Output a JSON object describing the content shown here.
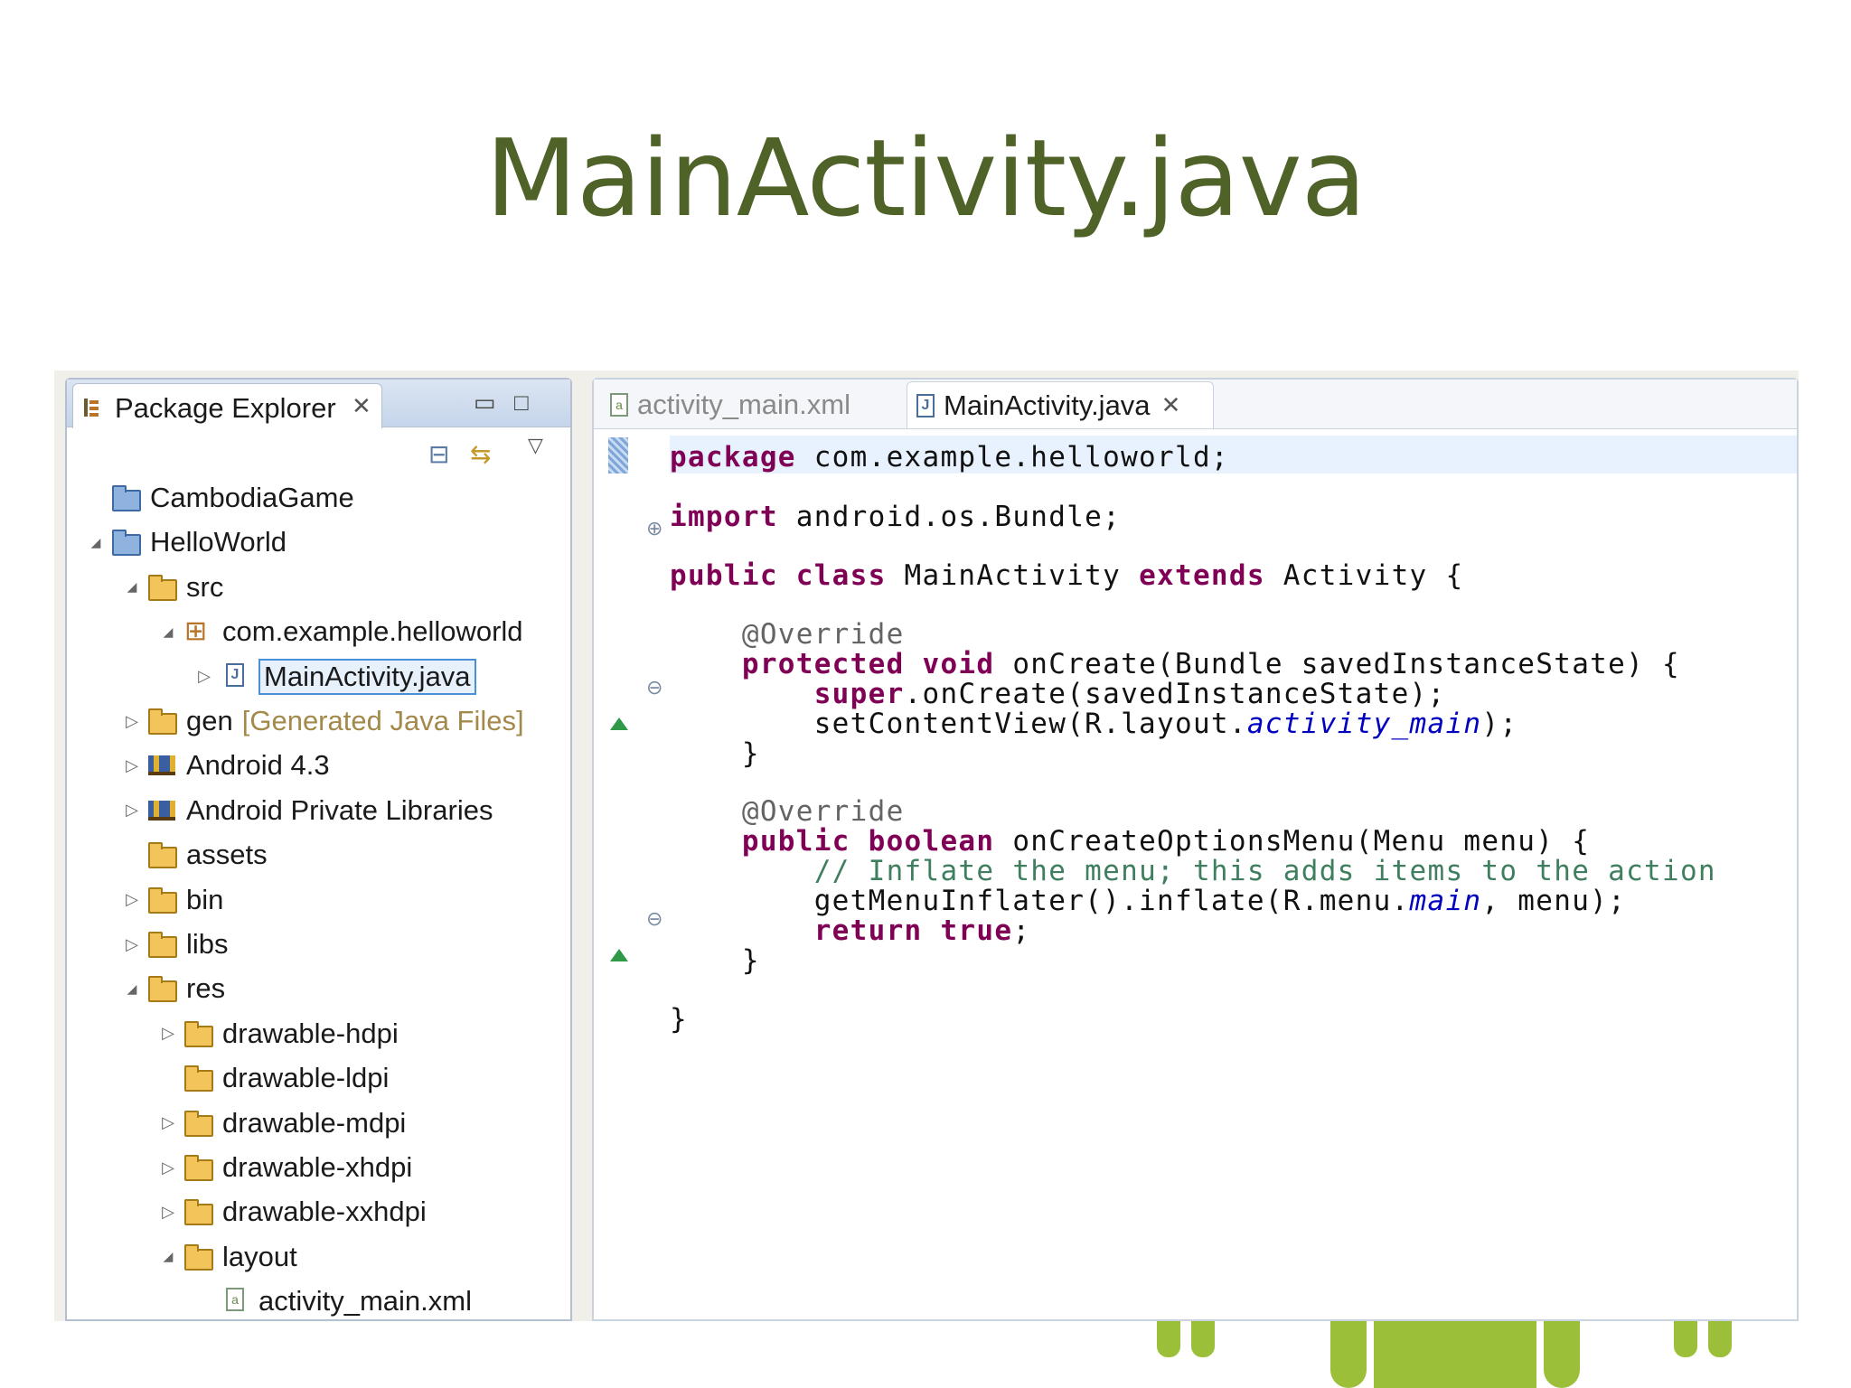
{
  "slide": {
    "title": "MainActivity.java"
  },
  "package_explorer": {
    "title": "Package Explorer",
    "tree": [
      {
        "label": "CambodiaGame",
        "indent": 0,
        "twisty": "",
        "icon": "project-closed-icon"
      },
      {
        "label": "HelloWorld",
        "indent": 0,
        "twisty": "expanded",
        "icon": "android-project-icon"
      },
      {
        "label": "src",
        "indent": 1,
        "twisty": "expanded",
        "icon": "source-folder-icon"
      },
      {
        "label": "com.example.helloworld",
        "indent": 2,
        "twisty": "expanded",
        "icon": "package-icon"
      },
      {
        "label": "MainActivity.java",
        "indent": 3,
        "twisty": "collapsed",
        "icon": "java-file-icon",
        "selected": true
      },
      {
        "label": "gen",
        "decor": "[Generated Java Files]",
        "indent": 1,
        "twisty": "collapsed",
        "icon": "source-folder-icon"
      },
      {
        "label": "Android 4.3",
        "indent": 1,
        "twisty": "collapsed",
        "icon": "library-icon"
      },
      {
        "label": "Android Private Libraries",
        "indent": 1,
        "twisty": "collapsed",
        "icon": "library-icon"
      },
      {
        "label": "assets",
        "indent": 1,
        "twisty": "",
        "icon": "folder-icon"
      },
      {
        "label": "bin",
        "indent": 1,
        "twisty": "collapsed",
        "icon": "folder-icon"
      },
      {
        "label": "libs",
        "indent": 1,
        "twisty": "collapsed",
        "icon": "folder-icon"
      },
      {
        "label": "res",
        "indent": 1,
        "twisty": "expanded",
        "icon": "folder-icon"
      },
      {
        "label": "drawable-hdpi",
        "indent": 2,
        "twisty": "collapsed",
        "icon": "folder-icon"
      },
      {
        "label": "drawable-ldpi",
        "indent": 2,
        "twisty": "",
        "icon": "folder-icon"
      },
      {
        "label": "drawable-mdpi",
        "indent": 2,
        "twisty": "collapsed",
        "icon": "folder-icon"
      },
      {
        "label": "drawable-xhdpi",
        "indent": 2,
        "twisty": "collapsed",
        "icon": "folder-icon"
      },
      {
        "label": "drawable-xxhdpi",
        "indent": 2,
        "twisty": "collapsed",
        "icon": "folder-icon"
      },
      {
        "label": "layout",
        "indent": 2,
        "twisty": "expanded",
        "icon": "folder-icon"
      },
      {
        "label": "activity_main.xml",
        "indent": 3,
        "twisty": "",
        "icon": "xml-file-icon"
      }
    ]
  },
  "editor": {
    "tabs": [
      {
        "label": "activity_main.xml",
        "active": false
      },
      {
        "label": "MainActivity.java",
        "active": true
      }
    ],
    "code": [
      [
        {
          "t": "package",
          "c": "kw"
        },
        {
          "t": " com.example.helloworld;"
        }
      ],
      [],
      [
        {
          "t": "import",
          "c": "kw"
        },
        {
          "t": " android.os.Bundle;"
        }
      ],
      [],
      [
        {
          "t": "public class",
          "c": "kw"
        },
        {
          "t": " MainActivity "
        },
        {
          "t": "extends",
          "c": "kw"
        },
        {
          "t": " Activity {"
        }
      ],
      [],
      [
        {
          "t": "    "
        },
        {
          "t": "@Override",
          "c": "ann"
        }
      ],
      [
        {
          "t": "    "
        },
        {
          "t": "protected void",
          "c": "kw"
        },
        {
          "t": " onCreate(Bundle savedInstanceState) {"
        }
      ],
      [
        {
          "t": "        "
        },
        {
          "t": "super",
          "c": "kw"
        },
        {
          "t": ".onCreate(savedInstanceState);"
        }
      ],
      [
        {
          "t": "        setContentView(R.layout."
        },
        {
          "t": "activity_main",
          "c": "fld"
        },
        {
          "t": ");"
        }
      ],
      [
        {
          "t": "    }"
        }
      ],
      [],
      [
        {
          "t": "    "
        },
        {
          "t": "@Override",
          "c": "ann"
        }
      ],
      [
        {
          "t": "    "
        },
        {
          "t": "public boolean",
          "c": "kw"
        },
        {
          "t": " onCreateOptionsMenu(Menu menu) {"
        }
      ],
      [
        {
          "t": "        "
        },
        {
          "t": "// Inflate the menu; this adds items to the action",
          "c": "cmt"
        }
      ],
      [
        {
          "t": "        getMenuInflater().inflate(R.menu."
        },
        {
          "t": "main",
          "c": "fld"
        },
        {
          "t": ", menu);"
        }
      ],
      [
        {
          "t": "        "
        },
        {
          "t": "return true",
          "c": "kw"
        },
        {
          "t": ";"
        }
      ],
      [
        {
          "t": "    }"
        }
      ],
      [],
      [
        {
          "t": "}"
        }
      ]
    ]
  }
}
